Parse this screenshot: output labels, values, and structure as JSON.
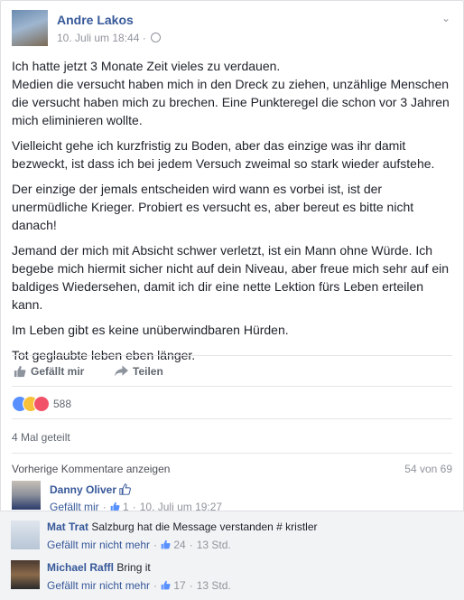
{
  "post": {
    "author": "Andre Lakos",
    "date": "10. Juli um 18:44",
    "meta_separator": "·",
    "paragraphs": [
      "Ich hatte jetzt 3 Monate Zeit vieles zu verdauen.\nMedien die versucht haben mich in den Dreck zu ziehen, unzählige Menschen die versucht haben mich zu brechen. Eine Punkteregel die schon vor 3 Jahren mich eliminieren wollte.",
      "Vielleicht gehe ich kurzfristig zu Boden, aber das einzige was ihr damit bezweckt, ist dass ich bei jedem Versuch zweimal so stark wieder aufstehe.",
      "Der einzige der jemals entscheiden wird wann es vorbei ist, ist der unermüdliche Krieger. Probiert es versucht es, aber bereut es bitte nicht danach!",
      "Jemand der mich mit Absicht schwer verletzt, ist ein Mann ohne Würde. Ich begebe mich hiermit sicher nicht auf dein Niveau, aber freue mich sehr auf ein baldiges Wiedersehen, damit ich dir eine nette Lektion fürs Leben erteilen kann.",
      "Im Leben gibt es keine unüberwindbaren Hürden.",
      "Tot geglaubte leben eben länger."
    ]
  },
  "actions": {
    "like": "Gefällt mir",
    "share": "Teilen"
  },
  "reactions": {
    "count": "588",
    "icons": [
      "like-icon",
      "wow-icon",
      "love-icon"
    ]
  },
  "shares": "4 Mal geteilt",
  "comments_nav": {
    "previous": "Vorherige Kommentare anzeigen",
    "position": "54 von 69"
  },
  "comments": [
    {
      "name": "Danny Oliver",
      "text": "",
      "like_label": "Gefällt mir",
      "likes": "1",
      "time": "10. Juli um 19:27"
    },
    {
      "name": "Mat Trat",
      "text": "Salzburg hat die Message verstanden # kristler",
      "like_label": "Gefällt mir nicht mehr",
      "likes": "24",
      "time": "13 Std."
    },
    {
      "name": "Michael Raffl",
      "text": "Bring it",
      "like_label": "Gefällt mir nicht mehr",
      "likes": "17",
      "time": "13 Std."
    }
  ],
  "colors": {
    "link": "#365899",
    "muted": "#90949c",
    "text": "#1d2129",
    "like_blue": "#5890ff",
    "love_red": "#f25268",
    "wow_yellow": "#f7c23a"
  }
}
